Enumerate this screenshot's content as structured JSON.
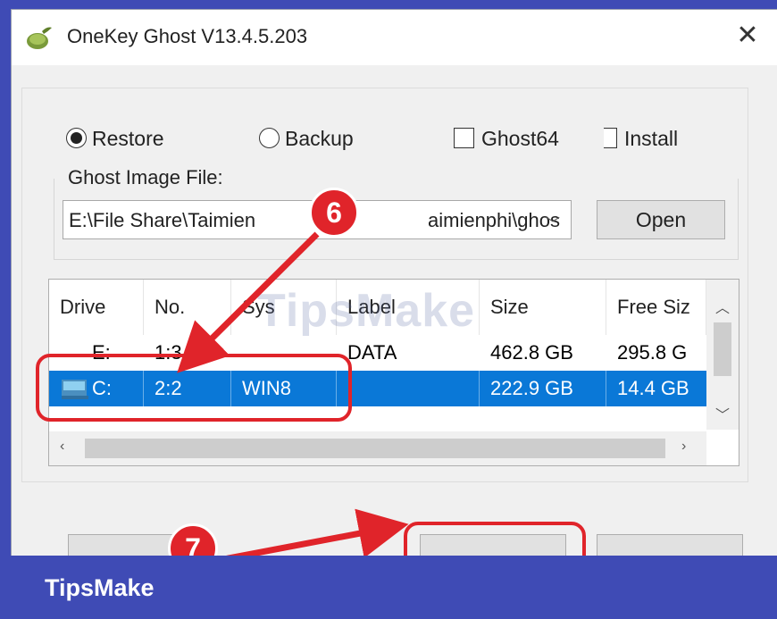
{
  "window": {
    "title": "OneKey Ghost V13.4.5.203"
  },
  "options": {
    "restore": "Restore",
    "backup": "Backup",
    "ghost64": "Ghost64",
    "install": "Install"
  },
  "image_file": {
    "label": "Ghost Image File:",
    "value": "E:\\File Share\\Taimien",
    "value_tail": "aimienphi\\ghos",
    "open_label": "Open"
  },
  "table": {
    "columns": [
      "Drive",
      "No.",
      "Sys",
      "Label",
      "Size",
      "Free Siz"
    ],
    "rows": [
      {
        "drive": "E:",
        "no": "1:3",
        "sys": "",
        "label": "DATA",
        "size": "462.8 GB",
        "free": "295.8 G"
      },
      {
        "drive": "C:",
        "no": "2:2",
        "sys": "WIN8",
        "label": "",
        "size": "222.9 GB",
        "free": "14.4 GB"
      }
    ]
  },
  "annotations": {
    "step_6": "6",
    "step_7": "7"
  },
  "watermark": "TipsMake",
  "footer": {
    "brand": "TipsMake"
  },
  "colors": {
    "selection": "#0a78d7",
    "annotation_red": "#e0242a",
    "banner_blue": "#3f4bb5"
  }
}
